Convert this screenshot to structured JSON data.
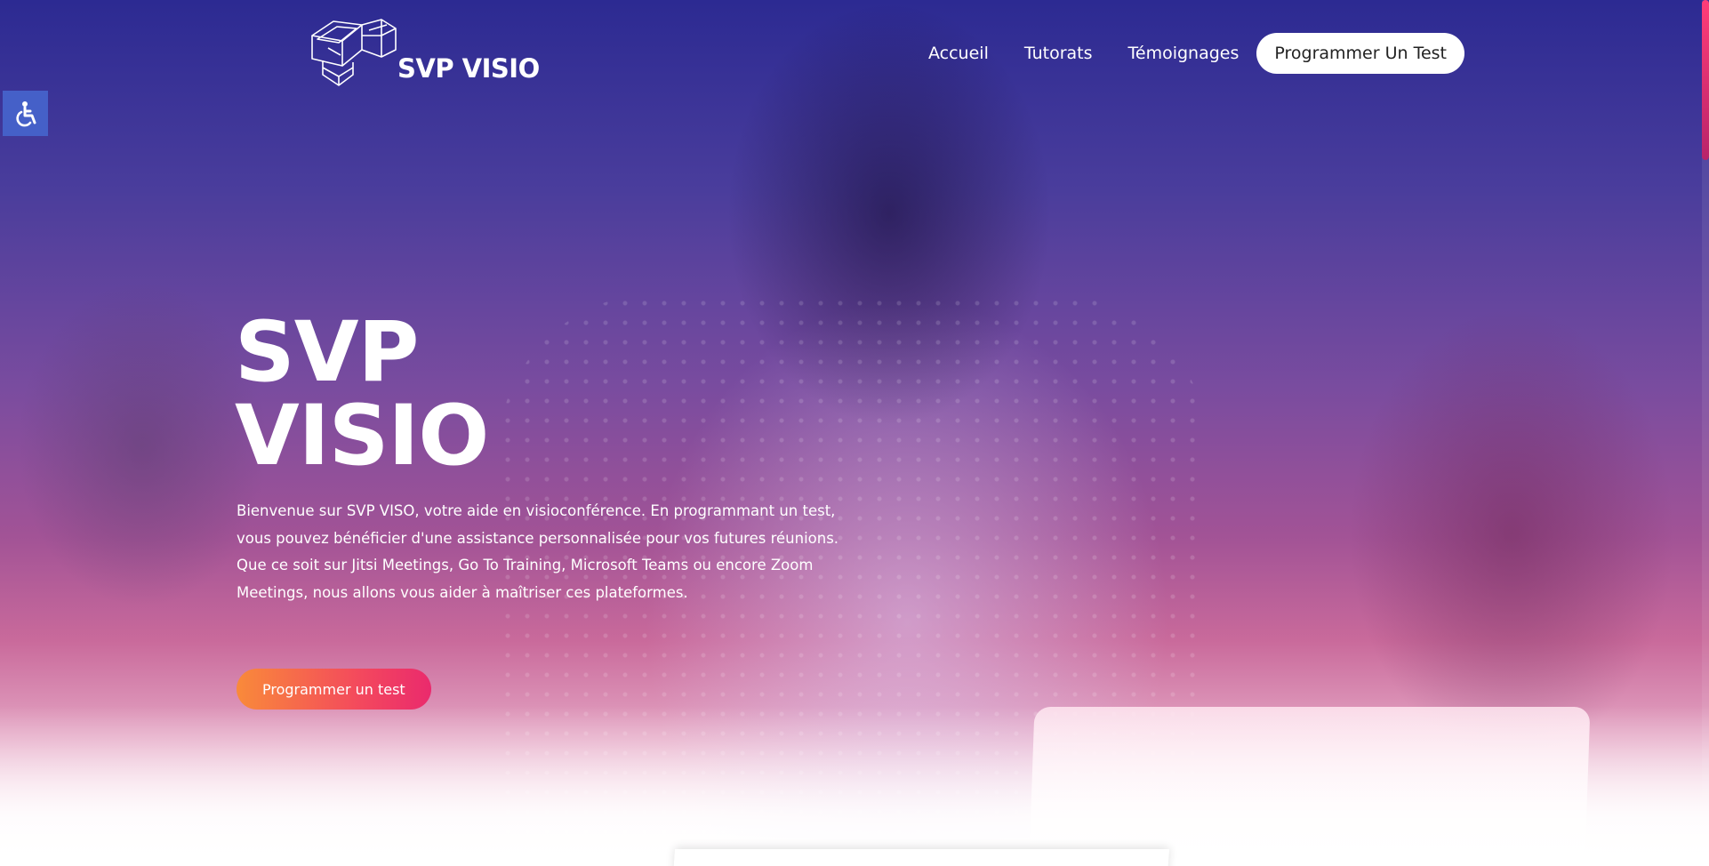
{
  "header": {
    "logo_text": "SVP VISIO",
    "nav": [
      {
        "label": "Accueil"
      },
      {
        "label": "Tutorats"
      },
      {
        "label": "Témoignages"
      },
      {
        "label": "Programmer Un Test"
      }
    ]
  },
  "accessibility": {
    "icon": "wheelchair-icon",
    "color": "#4560c8"
  },
  "hero": {
    "title_line1": "SVP",
    "title_line2": "VISIO",
    "description": "Bienvenue sur SVP VISO, votre aide en visioconférence. En programmant un test, vous pouvez bénéficier d'une assistance personnalisée pour vos futures réunions. Que ce soit sur Jitsi Meetings, Go To Training, Microsoft Teams ou encore Zoom Meetings, nous allons vous aider à maîtriser ces plateformes.",
    "button_label": "Programmer un test"
  },
  "colors": {
    "accent_gradient_start": "#f98a3a",
    "accent_gradient_end": "#ea2a6d",
    "hero_top": "#2c2a92",
    "scroll_thumb": "#ff3d78"
  }
}
